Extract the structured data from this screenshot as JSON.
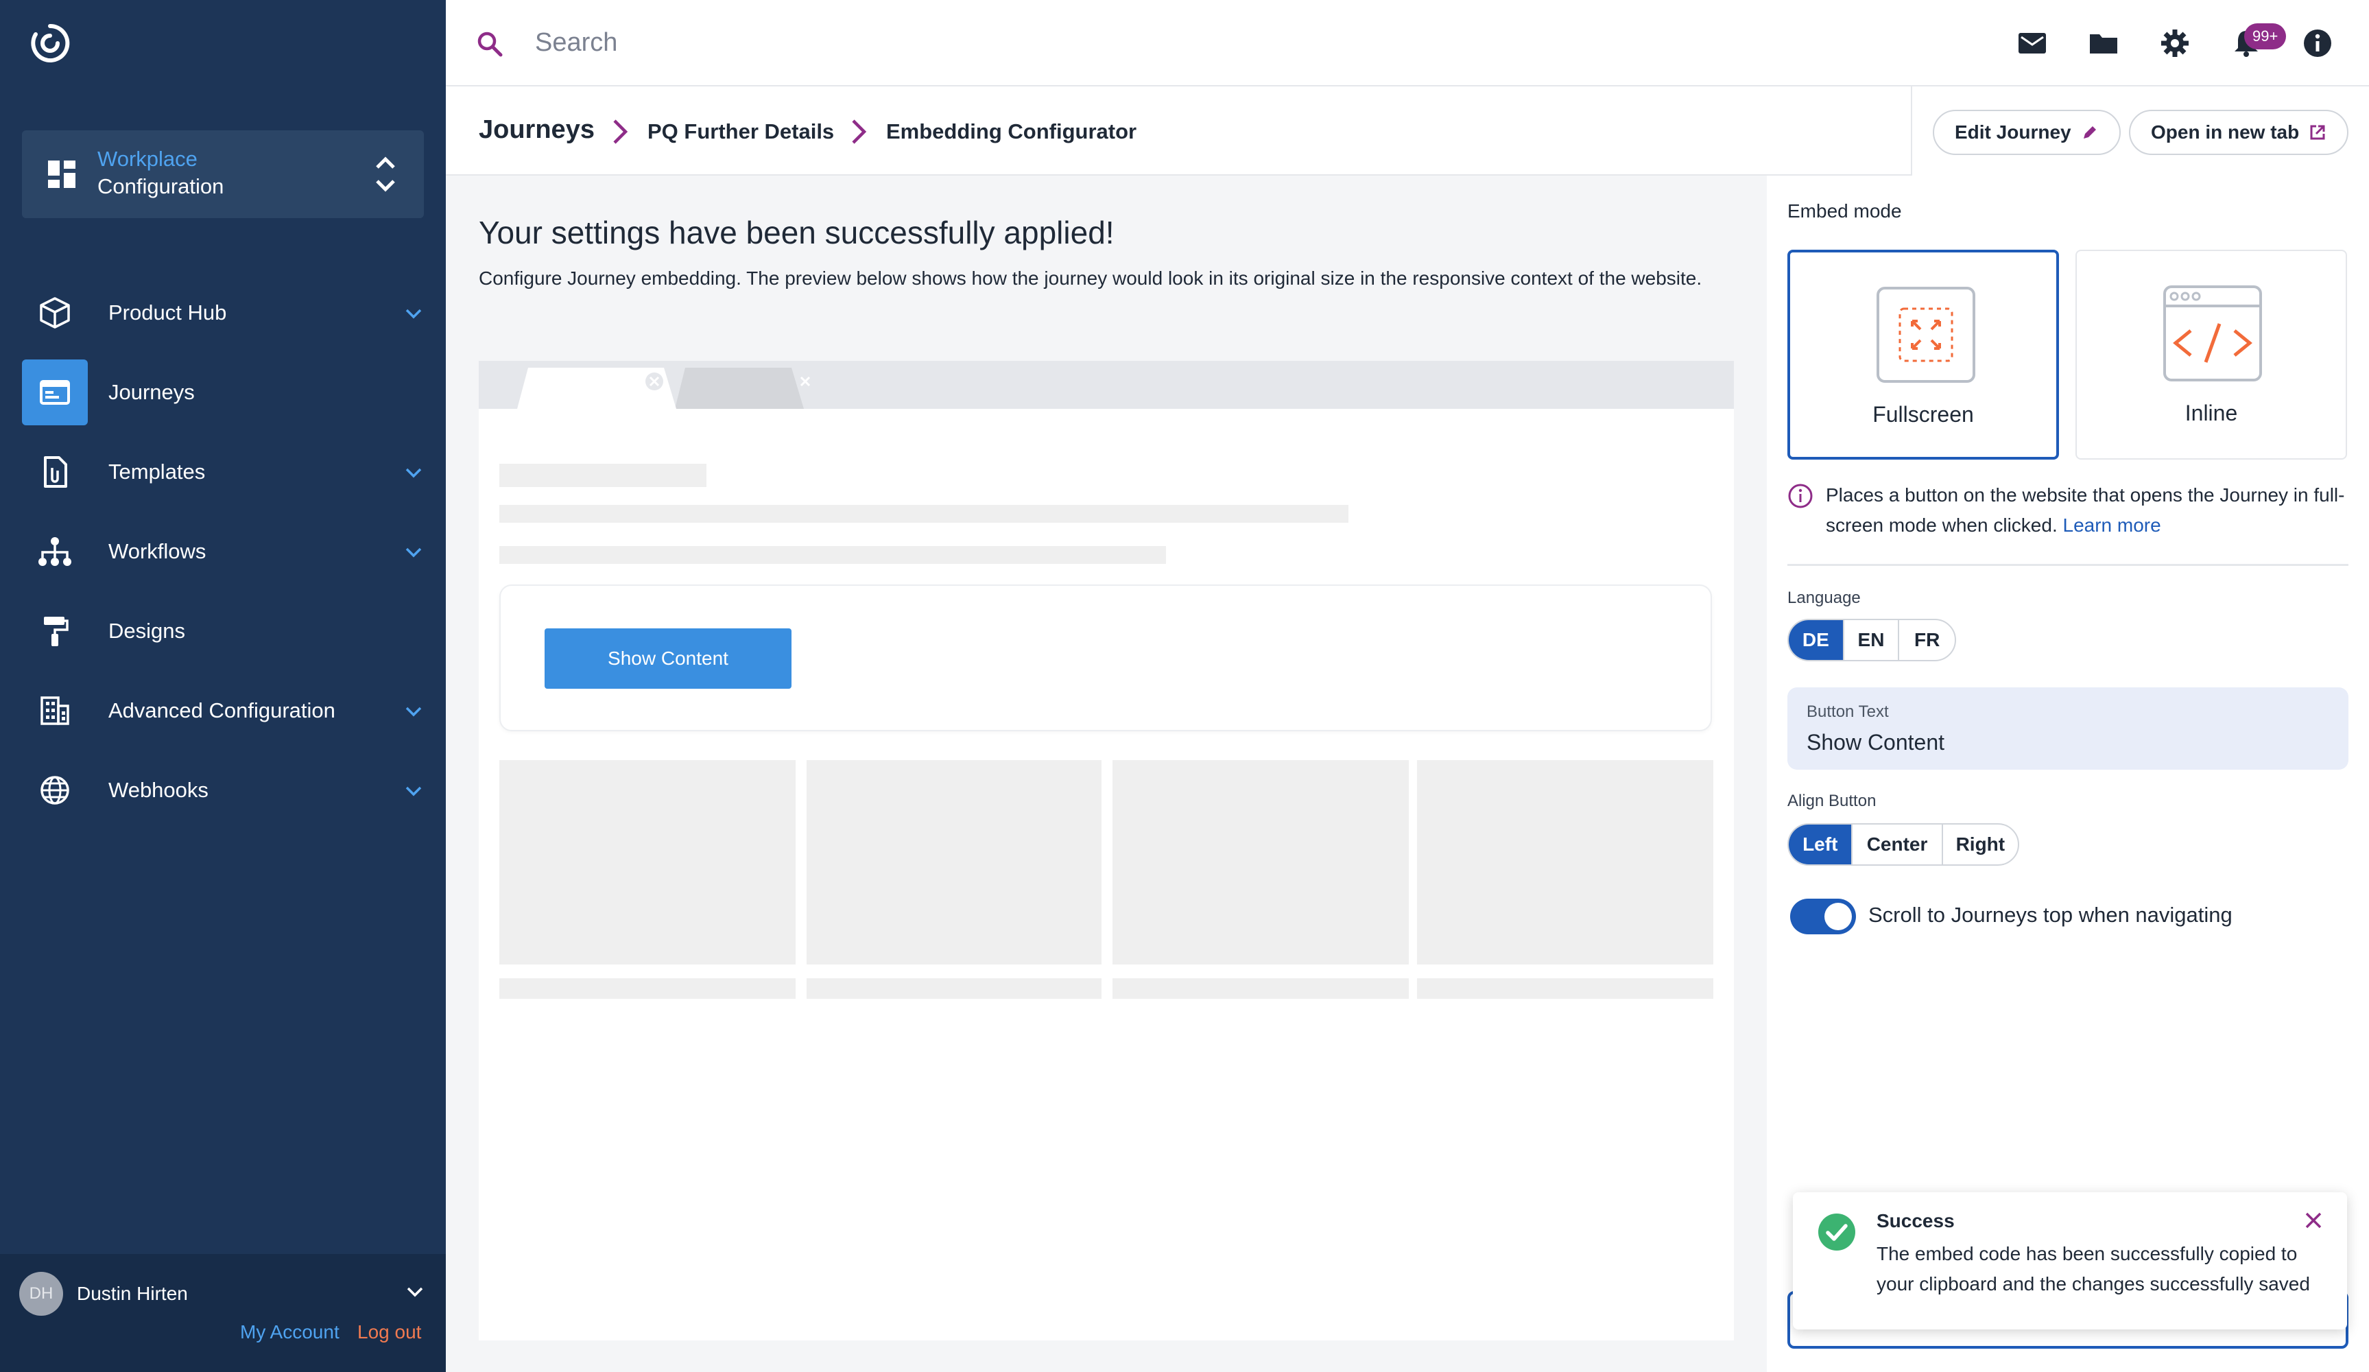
{
  "sidebar": {
    "workspace": {
      "line1": "Workplace",
      "line2": "Configuration"
    },
    "items": [
      {
        "label": "Product Hub",
        "icon": "box-icon",
        "has_children": true
      },
      {
        "label": "Journeys",
        "icon": "journey-icon",
        "has_children": false,
        "active": true
      },
      {
        "label": "Templates",
        "icon": "template-icon",
        "has_children": true
      },
      {
        "label": "Workflows",
        "icon": "workflow-icon",
        "has_children": true
      },
      {
        "label": "Designs",
        "icon": "paint-roller-icon",
        "has_children": false
      },
      {
        "label": "Advanced Configuration",
        "icon": "building-icon",
        "has_children": true
      },
      {
        "label": "Webhooks",
        "icon": "globe-icon",
        "has_children": true
      }
    ],
    "user": {
      "initials": "DH",
      "name": "Dustin Hirten",
      "my_account": "My Account",
      "log_out": "Log out"
    }
  },
  "topbar": {
    "search_placeholder": "Search",
    "notification_count": "99+"
  },
  "breadcrumb": {
    "items": [
      "Journeys",
      "PQ Further Details",
      "Embedding Configurator"
    ]
  },
  "header_actions": {
    "edit_journey": "Edit Journey",
    "open_new_tab": "Open in new tab"
  },
  "main": {
    "title": "Your settings have been successfully applied!",
    "description": "Configure Journey embedding. The preview below shows how the journey would look in its original size in the responsive context of the website.",
    "preview_button": "Show Content"
  },
  "panel": {
    "embed_mode_label": "Embed mode",
    "modes": [
      {
        "label": "Fullscreen",
        "selected": true
      },
      {
        "label": "Inline",
        "selected": false
      }
    ],
    "info_text": "Places a button on the website that opens the Journey in full-screen mode when clicked.",
    "learn_more": "Learn more",
    "language_label": "Language",
    "languages": [
      "DE",
      "EN",
      "FR"
    ],
    "language_selected": "DE",
    "button_text_label": "Button Text",
    "button_text_value": "Show Content",
    "align_label": "Align Button",
    "align_options": [
      "Left",
      "Center",
      "Right"
    ],
    "align_selected": "Left",
    "scroll_toggle_label": "Scroll to Journeys top when navigating",
    "scroll_toggle_on": true
  },
  "toast": {
    "title": "Success",
    "message": "The embed code has been successfully copied to your clipboard and the changes successfully saved"
  },
  "colors": {
    "sidebar_bg": "#1d3557",
    "accent_blue": "#3a8fe0",
    "primary_dark_blue": "#1e5bb8",
    "brand_purple": "#8e2c88",
    "success_green": "#3cb371",
    "icon_orange": "#f26b3a"
  }
}
